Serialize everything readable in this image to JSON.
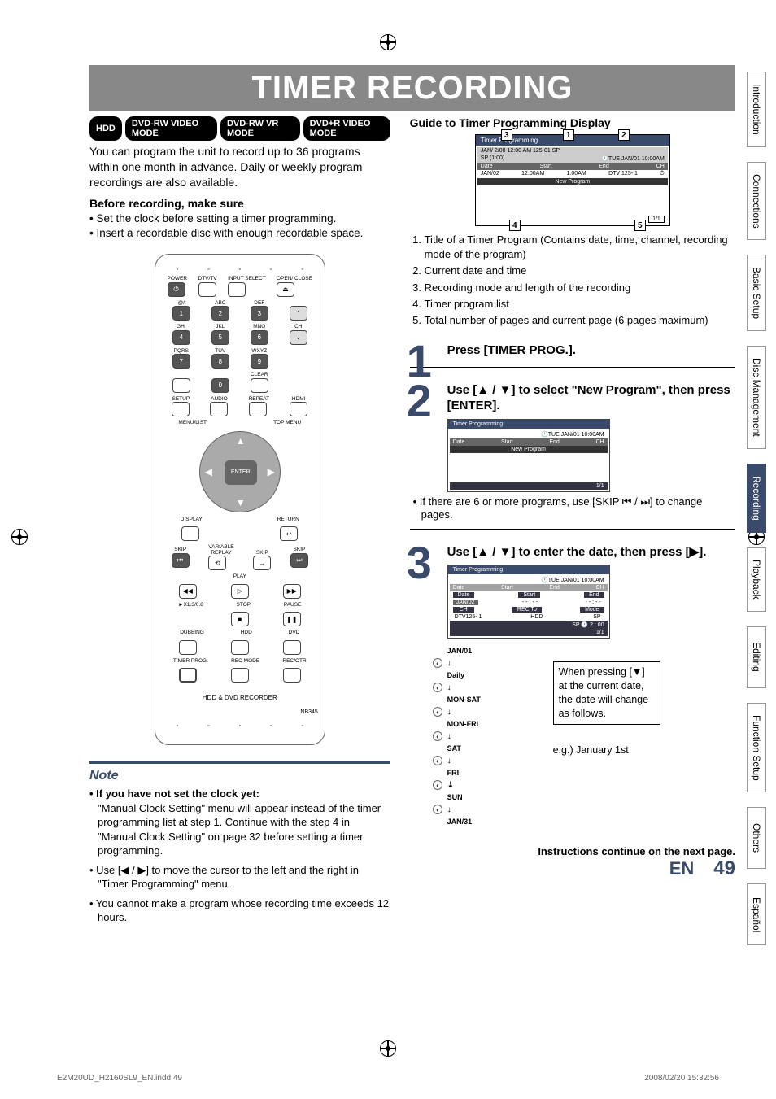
{
  "title": "TIMER RECORDING",
  "badges": [
    "HDD",
    "DVD-RW VIDEO MODE",
    "DVD-RW VR MODE",
    "DVD+R VIDEO MODE"
  ],
  "intro": "You can program the unit to record up to 36 programs within one month in advance. Daily or weekly program recordings are also available.",
  "before_h": "Before recording, make sure",
  "before_items": [
    "• Set the clock before setting a timer programming.",
    "• Insert a recordable disc with enough recordable space."
  ],
  "remote": {
    "row1": [
      "POWER",
      "DTV/TV",
      "INPUT SELECT",
      "OPEN/ CLOSE"
    ],
    "nums": [
      [
        ".@/:",
        "ABC",
        "DEF"
      ],
      [
        "1",
        "2",
        "3"
      ],
      [
        "GHI",
        "JKL",
        "MNO"
      ],
      [
        "4",
        "5",
        "6"
      ],
      [
        "PQRS",
        "TUV",
        "WXYZ"
      ],
      [
        "7",
        "8",
        "9"
      ],
      [
        "",
        "0",
        "CLEAR"
      ]
    ],
    "row3": [
      "SETUP",
      "AUDIO",
      "REPEAT",
      "HDMI"
    ],
    "menulist": "MENU/LIST",
    "topmenu": "TOP MENU",
    "enter": "ENTER",
    "display": "DISPLAY",
    "return": "RETURN",
    "skipL": "SKIP",
    "replay": "REPLAY",
    "varskip": "SKIP",
    "skipR": "SKIP",
    "variable": "VARIABLE",
    "play": "PLAY",
    "stop": "STOP",
    "pause": "PAUSE",
    "speed": "►X1.3/0.8",
    "dubbing": "DUBBING",
    "hdd": "HDD",
    "dvd": "DVD",
    "timerprog": "TIMER PROG.",
    "recmode": "REC MODE",
    "recotr": "REC/OTR",
    "model": "HDD & DVD RECORDER",
    "nb": "NB345",
    "ch": "CH"
  },
  "note_title": "Note",
  "note_items": [
    {
      "bold": "• If you have not set the clock yet:",
      "text": "\"Manual Clock Setting\" menu will appear instead of the timer programming list at step 1. Continue with the step 4 in \"Manual Clock Setting\" on page 32 before setting a timer programming."
    },
    {
      "bold": "",
      "text": "• Use [◀ / ▶] to move the cursor to the left and the right in \"Timer Programming\" menu."
    },
    {
      "bold": "",
      "text": "• You cannot make a program whose recording time exceeds 12 hours."
    }
  ],
  "guide_h": "Guide to Timer Programming Display",
  "tp_screen": {
    "header": "Timer Programming",
    "line1": "JAN/ 2/08  12:00 AM 125-01 SP",
    "line1r": "🕐TUE JAN/01 10:00AM",
    "line2": "SP (1:00)",
    "cols": [
      "Date",
      "Start",
      "End",
      "CH"
    ],
    "row": [
      "JAN/02",
      "12:00AM",
      "1:00AM",
      "DTV 125- 1"
    ],
    "newprog": "New Program",
    "pages": "1/1"
  },
  "legend": [
    "Title of a Timer Program (Contains date, time, channel, recording mode of the program)",
    "Current date and time",
    "Recording mode and length of the recording",
    "Timer program list",
    "Total number of pages and current page (6 pages maximum)"
  ],
  "step1": {
    "num": "1",
    "h": "Press [TIMER PROG.]."
  },
  "step2": {
    "num": "2",
    "h": "Use [▲ / ▼] to select \"New Program\", then press [ENTER].",
    "screen": {
      "header": "Timer Programming",
      "dt": "🕐TUE JAN/01 10:00AM",
      "cols": [
        "Date",
        "Start",
        "End",
        "CH"
      ],
      "newprog": "New Program",
      "pages": "1/1"
    },
    "sub": "• If there are 6 or more programs, use [SKIP ⏮ / ⏭] to change pages."
  },
  "step3": {
    "num": "3",
    "h": "Use [▲ / ▼] to enter the date, then press [▶].",
    "screen": {
      "header": "Timer Programming",
      "dt": "🕐TUE JAN/01 10:00AM",
      "cols": [
        "Date",
        "Start",
        "End",
        "CH"
      ],
      "r1": [
        "Date",
        "Start",
        "End"
      ],
      "r2": [
        "JAN/02",
        "- - : - -",
        "- - : - -"
      ],
      "r3": [
        "CH",
        "REC To",
        "Mode"
      ],
      "r4": [
        "DTV125- 1",
        "HDD",
        "SP"
      ],
      "rem": "SP 🕐 2 : 00",
      "pages": "1/1"
    },
    "dates": [
      "JAN/01",
      "Daily",
      "MON-SAT",
      "MON-FRI",
      "SAT",
      "FRI",
      "SUN",
      "JAN/31"
    ],
    "box": "When pressing [▼] at the current date, the date will change as follows.",
    "eg": "e.g.) January 1st"
  },
  "continue": "Instructions continue on the next page.",
  "page": {
    "en": "EN",
    "num": "49"
  },
  "tabs": [
    "Introduction",
    "Connections",
    "Basic Setup",
    "Disc Management",
    "Recording",
    "Playback",
    "Editing",
    "Function Setup",
    "Others",
    "Español"
  ],
  "footer": {
    "left": "E2M20UD_H2160SL9_EN.indd   49",
    "right": "2008/02/20   15:32:56"
  }
}
